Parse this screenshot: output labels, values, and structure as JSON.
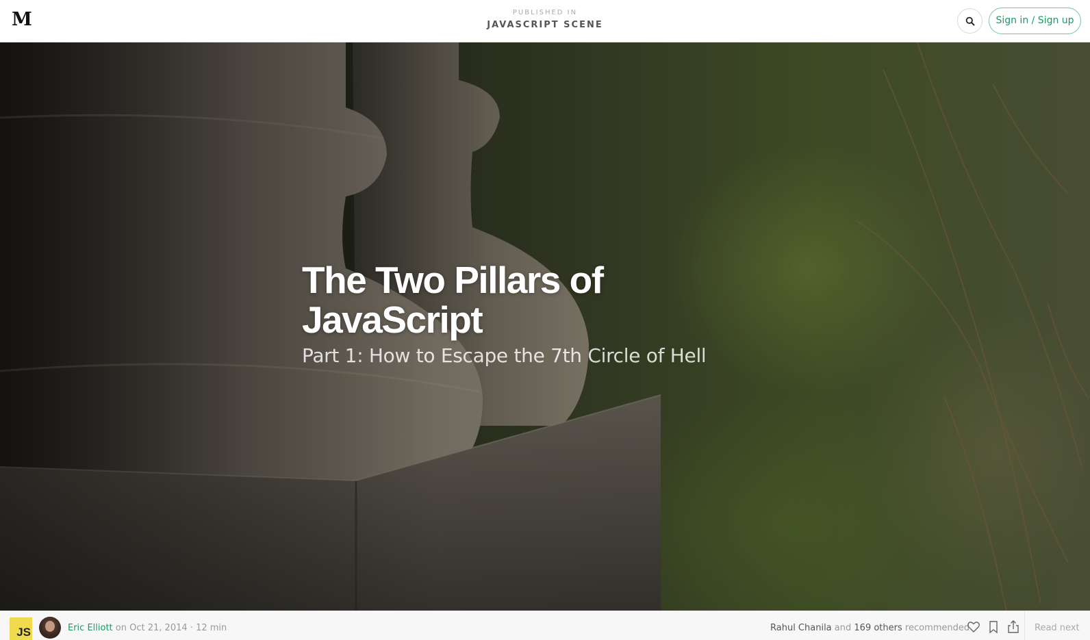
{
  "header": {
    "logo": "M",
    "published_label": "PUBLISHED IN",
    "publication": "JAVASCRIPT SCENE",
    "signin_label": "Sign in / Sign up",
    "search_icon": "search-icon"
  },
  "hero": {
    "title": "The Two Pillars of JavaScript",
    "subtitle": "Part 1: How to Escape the 7th Circle of Hell"
  },
  "meta": {
    "badge": "JS",
    "author": "Eric Elliott",
    "date_prefix": "on",
    "date": "Oct 21, 2014",
    "separator": "·",
    "read_time": "12 min",
    "recommender": "Rahul Chanila",
    "and_label": "and",
    "others": "169 others",
    "recommended_label": "recommended",
    "read_next": "Read next",
    "icons": [
      "heart-icon",
      "bookmark-icon",
      "share-icon"
    ]
  },
  "colors": {
    "accent_green": "#1c9963",
    "js_yellow": "#f0db4f"
  }
}
